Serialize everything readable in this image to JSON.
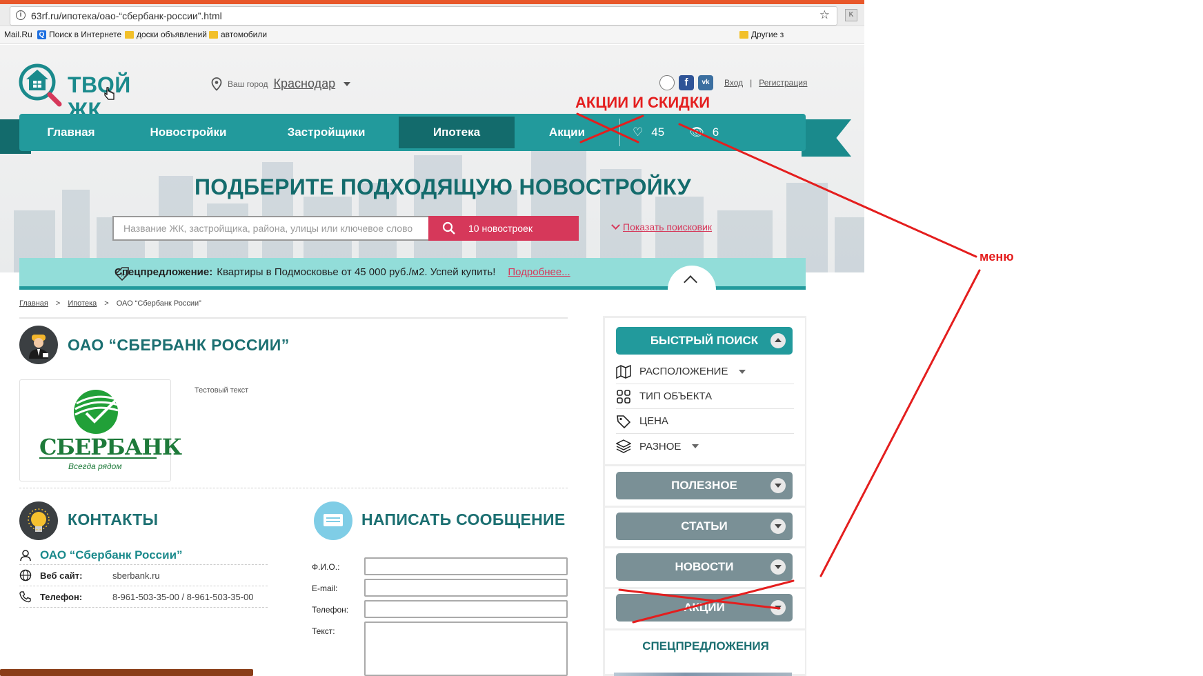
{
  "browser": {
    "url": "63rf.ru/ипотека/оао-“сбербанк-россии”.html",
    "extension_letter": "K",
    "bookmarks": [
      {
        "label": "Mail.Ru",
        "icon": "none"
      },
      {
        "label": "Поиск в Интернете",
        "icon": "search-q-icon"
      },
      {
        "label": "доски объявлений",
        "icon": "folder-icon"
      },
      {
        "label": "автомобили",
        "icon": "folder-icon"
      }
    ],
    "other_bookmarks": "Другие з"
  },
  "header": {
    "logo_text": "ТВОЙ ЖК",
    "city_label": "Ваш город",
    "city_name": "Краснодар",
    "login": "Вход",
    "separator": "|",
    "register": "Регистрация"
  },
  "annotations": {
    "promos_label": "АКЦИИ И СКИДКИ",
    "menu_label": "меню",
    "color": "#e41e1e"
  },
  "nav": {
    "items": [
      {
        "label": "Главная"
      },
      {
        "label": "Новостройки"
      },
      {
        "label": "Застройщики"
      },
      {
        "label": "Ипотека",
        "active": true
      },
      {
        "label": "Акции"
      }
    ],
    "favorites_count": "45",
    "views_count": "6"
  },
  "hero": {
    "title": "ПОДБЕРИТЕ ПОДХОДЯЩУЮ НОВОСТРОЙКУ",
    "search_placeholder": "Название ЖК, застройщика, района, улицы или ключевое слово",
    "search_button": "10 новостроек",
    "toggle": "Показать поисковик"
  },
  "special": {
    "label": "Спецпредложение:",
    "text": "Квартиры в Подмосковье от 45 000 руб./м2. Успей купить!",
    "more": "Подробнее..."
  },
  "breadcrumb": {
    "items": [
      "Главная",
      ">",
      "Ипотека",
      ">",
      "ОАО “Сбербанк России”"
    ]
  },
  "bank": {
    "title": "ОАО “СБЕРБАНК РОССИИ”",
    "logo_word": "СБЕРБАНК",
    "logo_slogan": "Всегда рядом",
    "description": "Тестовый текст"
  },
  "contacts": {
    "title": "КОНТАКТЫ",
    "org": "ОАО “Сбербанк России”",
    "website_label": "Веб сайт:",
    "website_value": "sberbank.ru",
    "phone_label": "Телефон:",
    "phone_value": "8-961-503-35-00 / 8-961-503-35-00"
  },
  "message_form": {
    "title": "НАПИСАТЬ СООБЩЕНИЕ",
    "fio_label": "Ф.И.О.:",
    "email_label": "E-mail:",
    "phone_label": "Телефон:",
    "text_label": "Текст:"
  },
  "sidebar": {
    "quick_search": "БЫСТРЫЙ ПОИСК",
    "filters": [
      {
        "label": "РАСПОЛОЖЕНИЕ",
        "icon": "map-icon",
        "dropdown": true
      },
      {
        "label": "ТИП ОБЪЕКТА",
        "icon": "grid-icon",
        "dropdown": false
      },
      {
        "label": "ЦЕНА",
        "icon": "price-tag-icon",
        "dropdown": false
      },
      {
        "label": "РАЗНОЕ",
        "icon": "layers-icon",
        "dropdown": true
      }
    ],
    "useful": "ПОЛЕЗНОЕ",
    "articles": "СТАТЬИ",
    "news": "НОВОСТИ",
    "promos": "АКЦИИ",
    "special_offers": "СПЕЦПРЕДЛОЖЕНИЯ"
  },
  "colors": {
    "teal": "#229a9c",
    "teal_dark": "#136b6c",
    "crimson": "#d6385a",
    "gray_button": "#7a9096",
    "sber_green": "#1e7a3a"
  }
}
